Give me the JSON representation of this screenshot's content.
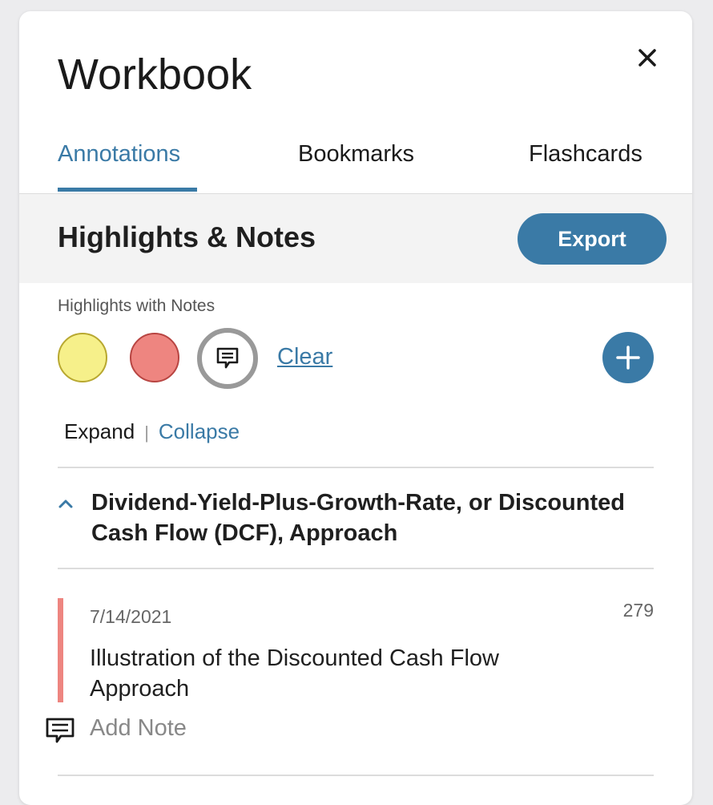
{
  "panel": {
    "title": "Workbook"
  },
  "tabs": [
    {
      "label": "Annotations",
      "active": true
    },
    {
      "label": "Bookmarks",
      "active": false
    },
    {
      "label": "Flashcards",
      "active": false
    }
  ],
  "section": {
    "title": "Highlights & Notes",
    "export_label": "Export"
  },
  "filters": {
    "label": "Highlights with Notes",
    "colors": [
      {
        "name": "yellow",
        "hex": "#f6f08a"
      },
      {
        "name": "red",
        "hex": "#ee8580"
      }
    ],
    "notes_icon": "comment-icon",
    "clear_label": "Clear",
    "add_icon": "plus-icon"
  },
  "expand": {
    "expand_label": "Expand",
    "separator": "|",
    "collapse_label": "Collapse"
  },
  "groups": [
    {
      "title": "Dividend-Yield-Plus-Growth-Rate, or Discounted Cash Flow (DCF), Approach",
      "expanded": true,
      "annotations": [
        {
          "date": "7/14/2021",
          "page": "279",
          "text": "Illustration of the Discounted Cash Flow Approach",
          "color": "#ee8580",
          "add_note_label": "Add Note"
        }
      ]
    }
  ],
  "colors": {
    "accent": "#3a7aa6",
    "highlight_red": "#ee8580",
    "highlight_yellow": "#f6f08a"
  }
}
